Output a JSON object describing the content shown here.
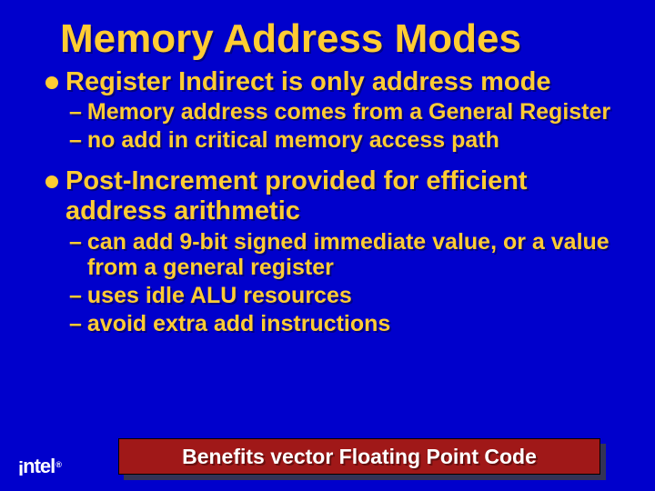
{
  "title": "Memory Address Modes",
  "bullets": [
    {
      "text": "Register Indirect is only address mode",
      "subs": [
        "Memory address comes from a General Register",
        "no add in critical memory access path"
      ]
    },
    {
      "text": "Post-Increment provided for efficient address arithmetic",
      "subs": [
        "can add 9-bit signed immediate value, or a value from a general register",
        "uses idle ALU resources",
        "avoid extra add instructions"
      ]
    }
  ],
  "callout": "Benefits vector Floating Point Code",
  "logo": "intel",
  "logo_reg": "®"
}
